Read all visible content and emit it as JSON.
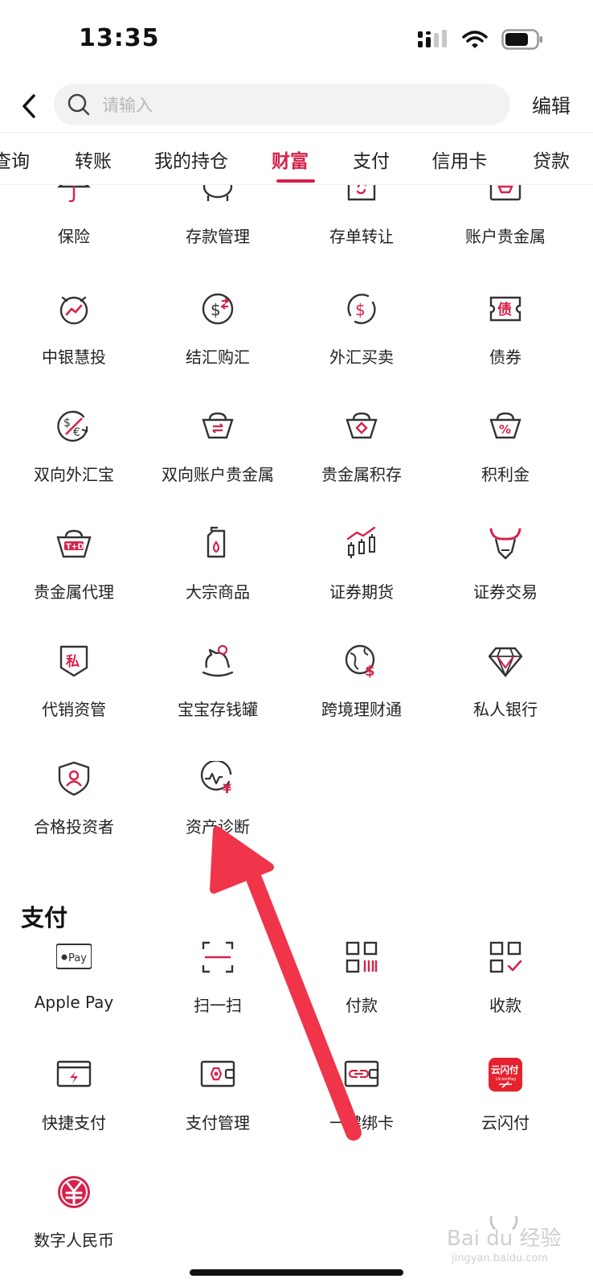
{
  "status": {
    "time": "13:35"
  },
  "header": {
    "search_placeholder": "请输入",
    "edit_label": "编辑"
  },
  "tabs": [
    {
      "label": "查询",
      "active": false
    },
    {
      "label": "转账",
      "active": false
    },
    {
      "label": "我的持仓",
      "active": false
    },
    {
      "label": "财富",
      "active": true
    },
    {
      "label": "支付",
      "active": false
    },
    {
      "label": "信用卡",
      "active": false
    },
    {
      "label": "贷款",
      "active": false
    }
  ],
  "wealth_items": [
    {
      "label": "保险",
      "icon": "umbrella-icon"
    },
    {
      "label": "存款管理",
      "icon": "piggy-bank-icon"
    },
    {
      "label": "存单转让",
      "icon": "certificate-transfer-icon"
    },
    {
      "label": "账户贵金属",
      "icon": "gold-account-icon"
    },
    {
      "label": "中银慧投",
      "icon": "alarm-chart-icon"
    },
    {
      "label": "结汇购汇",
      "icon": "currency-exchange-icon"
    },
    {
      "label": "外汇买卖",
      "icon": "forex-trade-icon"
    },
    {
      "label": "债券",
      "icon": "bond-ticket-icon"
    },
    {
      "label": "双向外汇宝",
      "icon": "dollar-euro-icon"
    },
    {
      "label": "双向账户贵金属",
      "icon": "gold-ingot-exchange-icon"
    },
    {
      "label": "贵金属积存",
      "icon": "gold-ingot-diamond-icon"
    },
    {
      "label": "积利金",
      "icon": "gold-ingot-percent-icon"
    },
    {
      "label": "贵金属代理",
      "icon": "gold-ingot-td-icon"
    },
    {
      "label": "大宗商品",
      "icon": "oil-can-icon"
    },
    {
      "label": "证券期货",
      "icon": "candlestick-icon"
    },
    {
      "label": "证券交易",
      "icon": "bull-icon"
    },
    {
      "label": "代销资管",
      "icon": "private-shield-icon"
    },
    {
      "label": "宝宝存钱罐",
      "icon": "rocking-horse-icon"
    },
    {
      "label": "跨境理财通",
      "icon": "globe-dollar-icon"
    },
    {
      "label": "私人银行",
      "icon": "diamond-icon"
    },
    {
      "label": "合格投资者",
      "icon": "user-shield-icon"
    },
    {
      "label": "资产诊断",
      "icon": "pulse-yuan-icon"
    }
  ],
  "pay_section": {
    "title": "支付",
    "items": [
      {
        "label": "Apple Pay",
        "icon": "apple-pay-icon",
        "icon_text": "Pay"
      },
      {
        "label": "扫一扫",
        "icon": "scan-icon"
      },
      {
        "label": "付款",
        "icon": "pay-code-icon"
      },
      {
        "label": "收款",
        "icon": "receive-code-icon"
      },
      {
        "label": "快捷支付",
        "icon": "quick-pay-card-icon"
      },
      {
        "label": "支付管理",
        "icon": "wallet-settings-icon"
      },
      {
        "label": "一键绑卡",
        "icon": "bind-card-icon"
      },
      {
        "label": "云闪付",
        "icon": "unionpay-quickpass-icon",
        "icon_text": "云闪付",
        "icon_subtext": "UnionPay"
      },
      {
        "label": "数字人民币",
        "icon": "digital-rmb-icon"
      }
    ]
  },
  "watermark": {
    "text": "Bai du 经验",
    "subtext": "jingyan.baidu.com"
  },
  "colors": {
    "accent": "#d6224a",
    "text": "#222222",
    "annotation": "#f0344a"
  }
}
